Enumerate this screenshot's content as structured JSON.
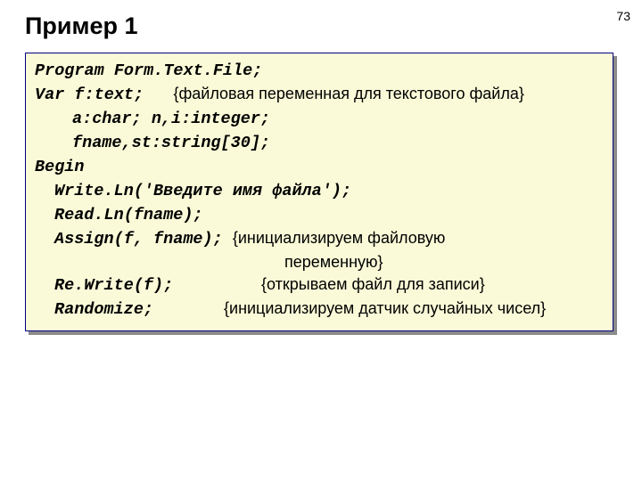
{
  "page_number": "73",
  "title": "Пример 1",
  "code": {
    "l1": "Program Form.Text.File;",
    "l2a": "Var f:text;",
    "l2c": "{файловая переменная для текстового файла}",
    "l3": "a:char; n,i:integer;",
    "l4": "fname,st:string[30];",
    "l5": "Begin",
    "l6": "Write.Ln('Введите имя файла');",
    "l7": "Read.Ln(fname);",
    "l8a": "Assign(f, fname);",
    "l8c": "{инициализируем файловую",
    "l9c": "переменную}",
    "l10a": "Re.Write(f);",
    "l10c": "{открываем файл для записи}",
    "l11a": "Randomize;",
    "l11c": "{инициализируем датчик случайных чисел}"
  }
}
